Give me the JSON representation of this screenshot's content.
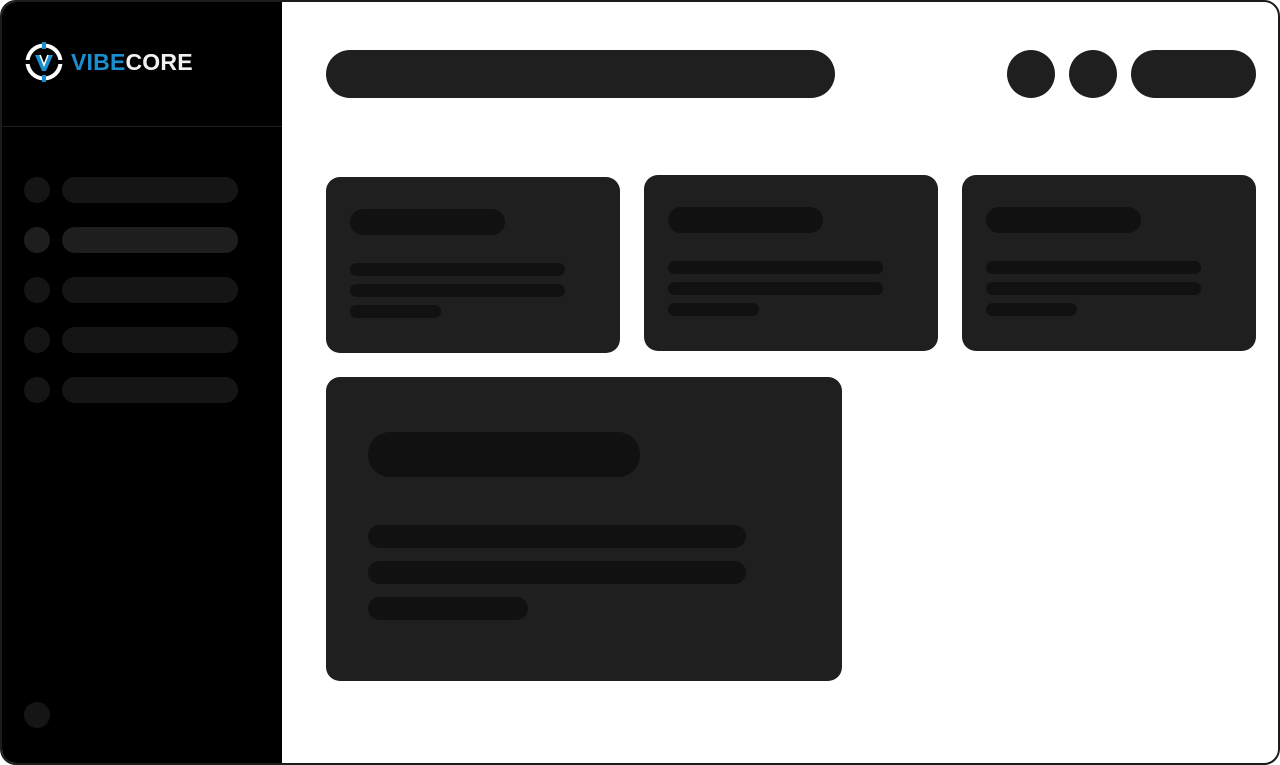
{
  "brand": {
    "name_part1": "VIBE",
    "name_part2": "CORE",
    "logo_icon": "vibecore-logo-icon",
    "accent_color": "#1a8fcf"
  },
  "sidebar": {
    "items": [
      {
        "name": "sidebar-item-1",
        "active": false
      },
      {
        "name": "sidebar-item-2",
        "active": true
      },
      {
        "name": "sidebar-item-3",
        "active": false
      },
      {
        "name": "sidebar-item-4",
        "active": false
      },
      {
        "name": "sidebar-item-5",
        "active": false
      }
    ]
  },
  "header": {
    "search": {
      "placeholder": ""
    },
    "buttons": [
      {
        "name": "header-icon-button-1"
      },
      {
        "name": "header-icon-button-2"
      },
      {
        "name": "header-action-button"
      }
    ]
  },
  "colors": {
    "sidebar_bg": "#000000",
    "skeleton": "#1f1f1f",
    "skeleton_inner": "#111111",
    "page_bg": "#ffffff"
  }
}
